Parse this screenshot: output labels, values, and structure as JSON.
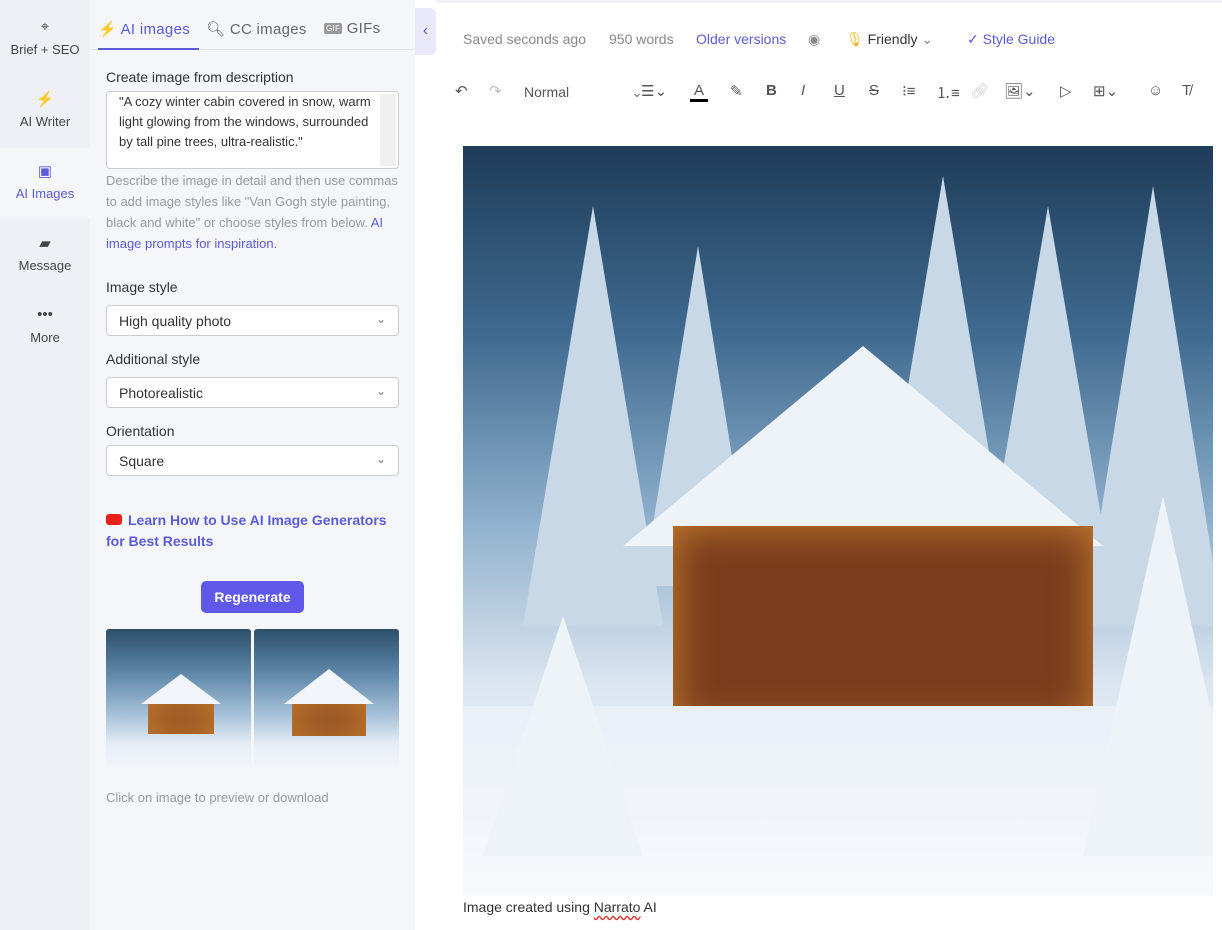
{
  "rail": {
    "items": [
      {
        "label": "Brief + SEO",
        "icon": "crosshair-icon"
      },
      {
        "label": "AI Writer",
        "icon": "lightning-icon"
      },
      {
        "label": "AI Images",
        "icon": "image-icon",
        "active": true
      },
      {
        "label": "Message",
        "icon": "message-icon"
      },
      {
        "label": "More",
        "icon": "more-icon"
      }
    ]
  },
  "panel": {
    "tabs": [
      {
        "label": "AI images",
        "icon": "lightning-icon",
        "active": true
      },
      {
        "label": "CC images",
        "icon": "search-icon"
      },
      {
        "label": "GIFs",
        "icon": "gif-icon"
      }
    ],
    "description_label": "Create image from description",
    "description_value": "\"A cozy winter cabin covered in snow, warm light glowing from the windows, surrounded by tall pine trees, ultra-realistic.\"",
    "hint": "Describe the image in detail and then use commas to add image styles like \"Van Gogh style painting, black and white\" or choose styles from below.",
    "hint_link": "AI image prompts for inspiration.",
    "image_style_label": "Image style",
    "image_style_value": "High quality photo",
    "additional_style_label": "Additional style",
    "additional_style_value": "Photorealistic",
    "orientation_label": "Orientation",
    "orientation_value": "Square",
    "learn_link": "Learn How to Use AI Image Generators for Best Results",
    "regenerate": "Regenerate",
    "thumb_hint": "Click on image to preview or download"
  },
  "header": {
    "saved": "Saved seconds ago",
    "words": "950 words",
    "older_versions": "Older versions",
    "tone": "Friendly",
    "style_guide": "Style Guide"
  },
  "toolbar": {
    "format": "Normal"
  },
  "editor": {
    "caption_prefix": "Image created using ",
    "caption_brand": "Narrato",
    "caption_suffix": " AI"
  },
  "colors": {
    "accent": "#5b5bd6",
    "button": "#6058e8",
    "youtube": "#e62117"
  }
}
